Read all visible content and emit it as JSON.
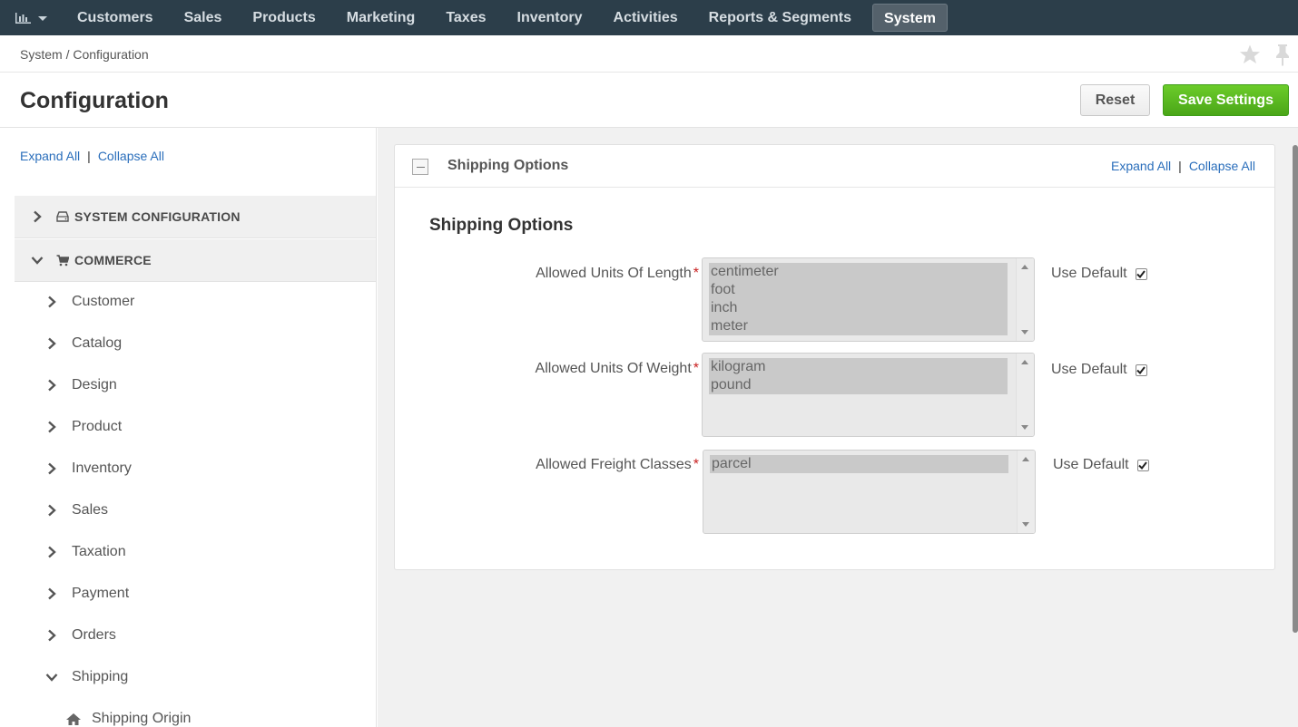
{
  "nav": {
    "items": [
      "Customers",
      "Sales",
      "Products",
      "Marketing",
      "Taxes",
      "Inventory",
      "Activities",
      "Reports & Segments"
    ],
    "active": "System"
  },
  "breadcrumb": "System / Configuration",
  "header": {
    "title": "Configuration",
    "reset_label": "Reset",
    "save_label": "Save Settings"
  },
  "sidebar": {
    "expand_all": "Expand All",
    "collapse_all": "Collapse All",
    "separator": "|",
    "sections": [
      "SYSTEM CONFIGURATION",
      "COMMERCE"
    ],
    "items": [
      "Customer",
      "Catalog",
      "Design",
      "Product",
      "Inventory",
      "Sales",
      "Taxation",
      "Payment",
      "Orders",
      "Shipping"
    ],
    "subitem": "Shipping Origin"
  },
  "panel": {
    "title": "Shipping Options",
    "expand_all": "Expand All",
    "collapse_all": "Collapse All",
    "separator": "|",
    "section_title": "Shipping Options",
    "required_mark": "*",
    "use_default_label": "Use Default",
    "fields": [
      {
        "label": "Allowed Units Of Length",
        "options": [
          "centimeter",
          "foot",
          "inch",
          "meter"
        ],
        "use_default": true
      },
      {
        "label": "Allowed Units Of Weight",
        "options": [
          "kilogram",
          "pound"
        ],
        "use_default": true
      },
      {
        "label": "Allowed Freight Classes",
        "options": [
          "parcel"
        ],
        "use_default": true
      }
    ]
  },
  "colors": {
    "nav_bg": "#2c3e4a",
    "link": "#2a6ebb",
    "save_button": "#5cb81f",
    "required": "#c81e1e"
  }
}
